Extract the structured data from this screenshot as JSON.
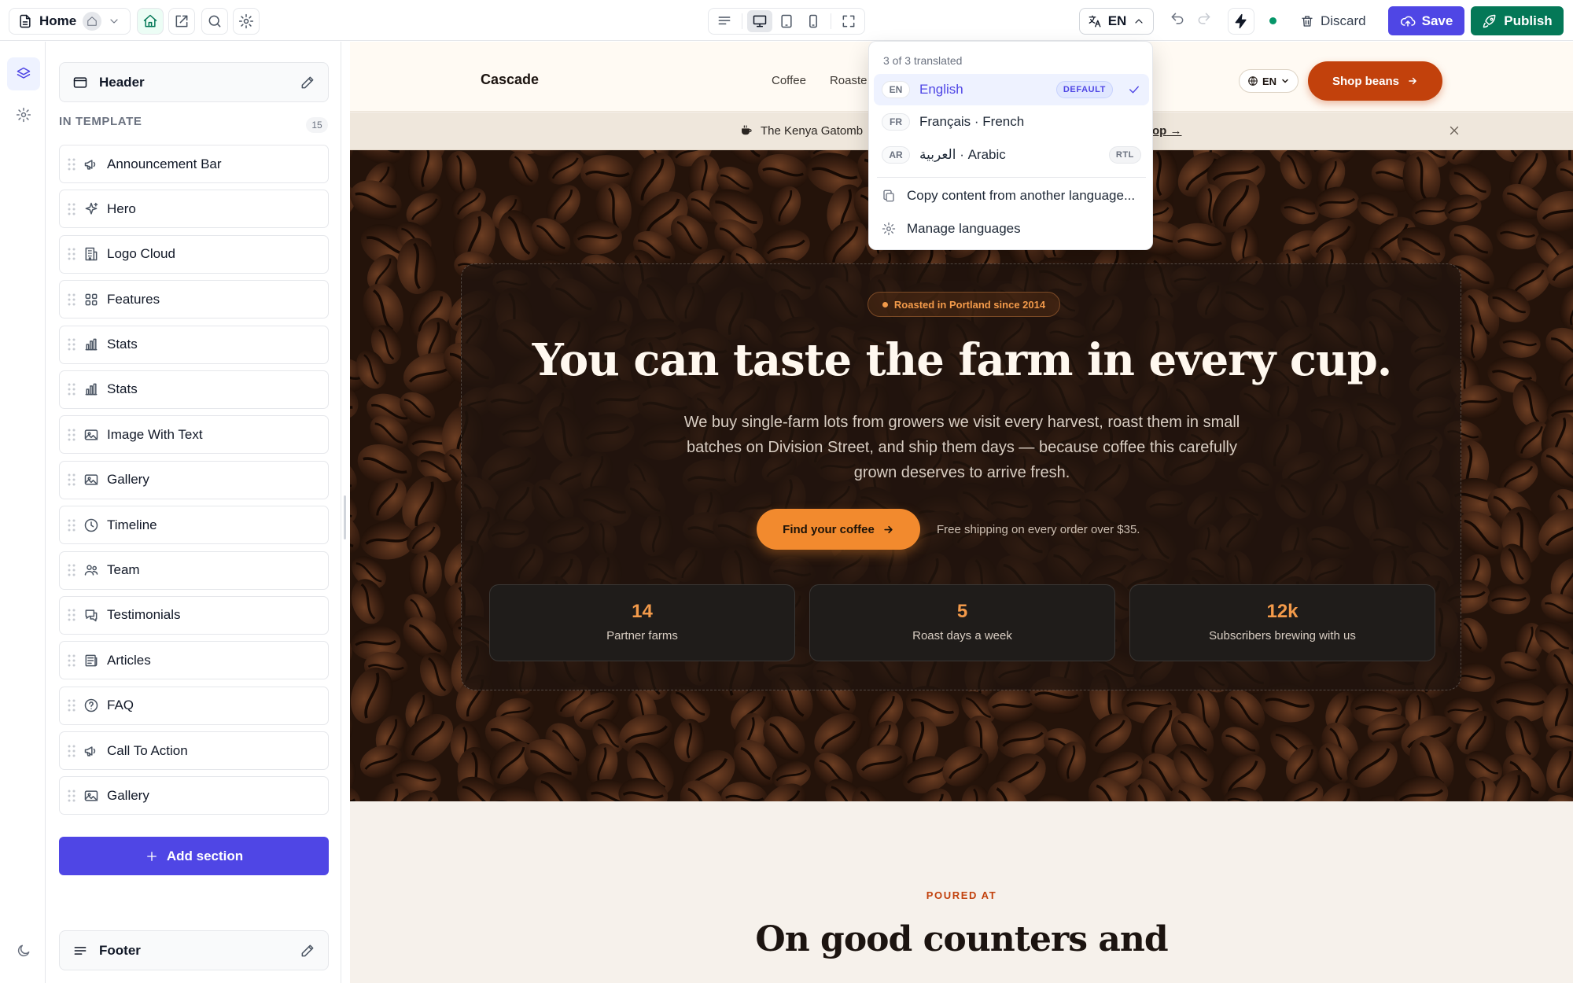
{
  "toolbar": {
    "page_name": "Home",
    "language_code": "EN",
    "discard_label": "Discard",
    "save_label": "Save",
    "publish_label": "Publish"
  },
  "panel": {
    "header_label": "Header",
    "template_heading": "IN TEMPLATE",
    "template_count": "15",
    "sections": [
      {
        "label": "Announcement Bar",
        "icon": "megaphone-icon"
      },
      {
        "label": "Hero",
        "icon": "sparkles-icon"
      },
      {
        "label": "Logo Cloud",
        "icon": "building-icon"
      },
      {
        "label": "Features",
        "icon": "grid-icon"
      },
      {
        "label": "Stats",
        "icon": "bar-chart-icon"
      },
      {
        "label": "Stats",
        "icon": "bar-chart-icon"
      },
      {
        "label": "Image With Text",
        "icon": "image-icon"
      },
      {
        "label": "Gallery",
        "icon": "image-icon"
      },
      {
        "label": "Timeline",
        "icon": "clock-icon"
      },
      {
        "label": "Team",
        "icon": "users-icon"
      },
      {
        "label": "Testimonials",
        "icon": "chat-icon"
      },
      {
        "label": "Articles",
        "icon": "newspaper-icon"
      },
      {
        "label": "FAQ",
        "icon": "help-circle-icon"
      },
      {
        "label": "Call To Action",
        "icon": "megaphone-icon"
      },
      {
        "label": "Gallery",
        "icon": "image-icon"
      }
    ],
    "add_section_label": "Add section",
    "footer_label": "Footer"
  },
  "site": {
    "brand": "Cascade",
    "nav": [
      "Coffee",
      "Roaste"
    ],
    "lang": "EN",
    "shop_label": "Shop beans",
    "announcement_text": "The Kenya Gatomb",
    "announcement_link": "op"
  },
  "hero": {
    "badge": "Roasted in Portland since 2014",
    "title": "You can taste the farm in every cup.",
    "subtitle": "We buy single-farm lots from growers we visit every harvest, roast them in small batches on Division Street, and ship them days — because coffee this carefully grown deserves to arrive fresh.",
    "cta_label": "Find your coffee",
    "shipping_note": "Free shipping on every order over $35.",
    "stats": [
      {
        "value": "14",
        "label": "Partner farms"
      },
      {
        "value": "5",
        "label": "Roast days a week"
      },
      {
        "value": "12k",
        "label": "Subscribers brewing with us"
      }
    ]
  },
  "next_section": {
    "eyebrow": "POURED AT",
    "title": "On good counters and"
  },
  "language_menu": {
    "summary": "3 of 3 translated",
    "languages": [
      {
        "code": "EN",
        "name": "English",
        "tag": "DEFAULT",
        "selected": true
      },
      {
        "code": "FR",
        "name": "Français · French",
        "tag": "",
        "selected": false
      },
      {
        "code": "AR",
        "name": "العربية · Arabic",
        "tag": "RTL",
        "selected": false
      }
    ],
    "copy_action": "Copy content from another language...",
    "manage_action": "Manage languages"
  },
  "colors": {
    "primary": "#4f46e5",
    "publish": "#047857",
    "accent_orange": "#f28a2e",
    "brand_rust": "#c2410c"
  }
}
